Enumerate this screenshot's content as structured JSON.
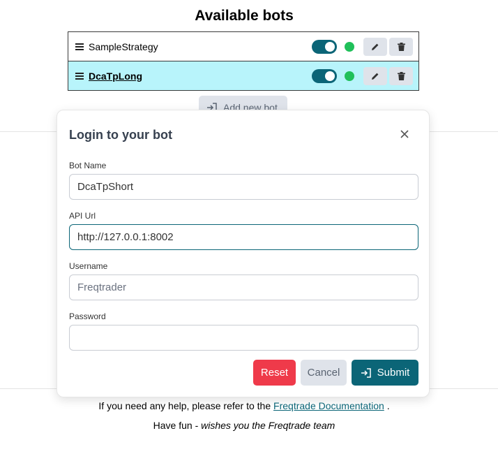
{
  "page": {
    "title": "Available bots"
  },
  "bots": [
    {
      "name": "SampleStrategy",
      "active": false,
      "enabled": true,
      "status_color": "#20c05a"
    },
    {
      "name": "DcaTpLong",
      "active": true,
      "enabled": true,
      "status_color": "#20c05a"
    }
  ],
  "add_bot": {
    "label": "Add new bot"
  },
  "modal": {
    "title": "Login to your bot",
    "fields": {
      "bot_name": {
        "label": "Bot Name",
        "value": "DcaTpShort",
        "placeholder": ""
      },
      "api_url": {
        "label": "API Url",
        "value": "http://127.0.0.1:8002",
        "placeholder": ""
      },
      "username": {
        "label": "Username",
        "value": "",
        "placeholder": "Freqtrader"
      },
      "password": {
        "label": "Password",
        "value": "",
        "placeholder": ""
      }
    },
    "buttons": {
      "reset": "Reset",
      "cancel": "Cancel",
      "submit": "Submit"
    }
  },
  "footer": {
    "help_prefix": "If you need any help, please refer to the",
    "help_link": "Freqtrade Documentation",
    "help_suffix": ".",
    "fun_prefix": "Have fun -",
    "fun_signature": "wishes you the Freqtrade team"
  },
  "colors": {
    "accent": "#0b6577",
    "active_row": "#b8f4fb",
    "status_online": "#20c05a",
    "danger": "#ef3a4a",
    "secondary": "#dfe3ea"
  },
  "icons": [
    "drag-handle-icon",
    "pencil-icon",
    "trash-icon",
    "login-icon",
    "close-icon"
  ]
}
